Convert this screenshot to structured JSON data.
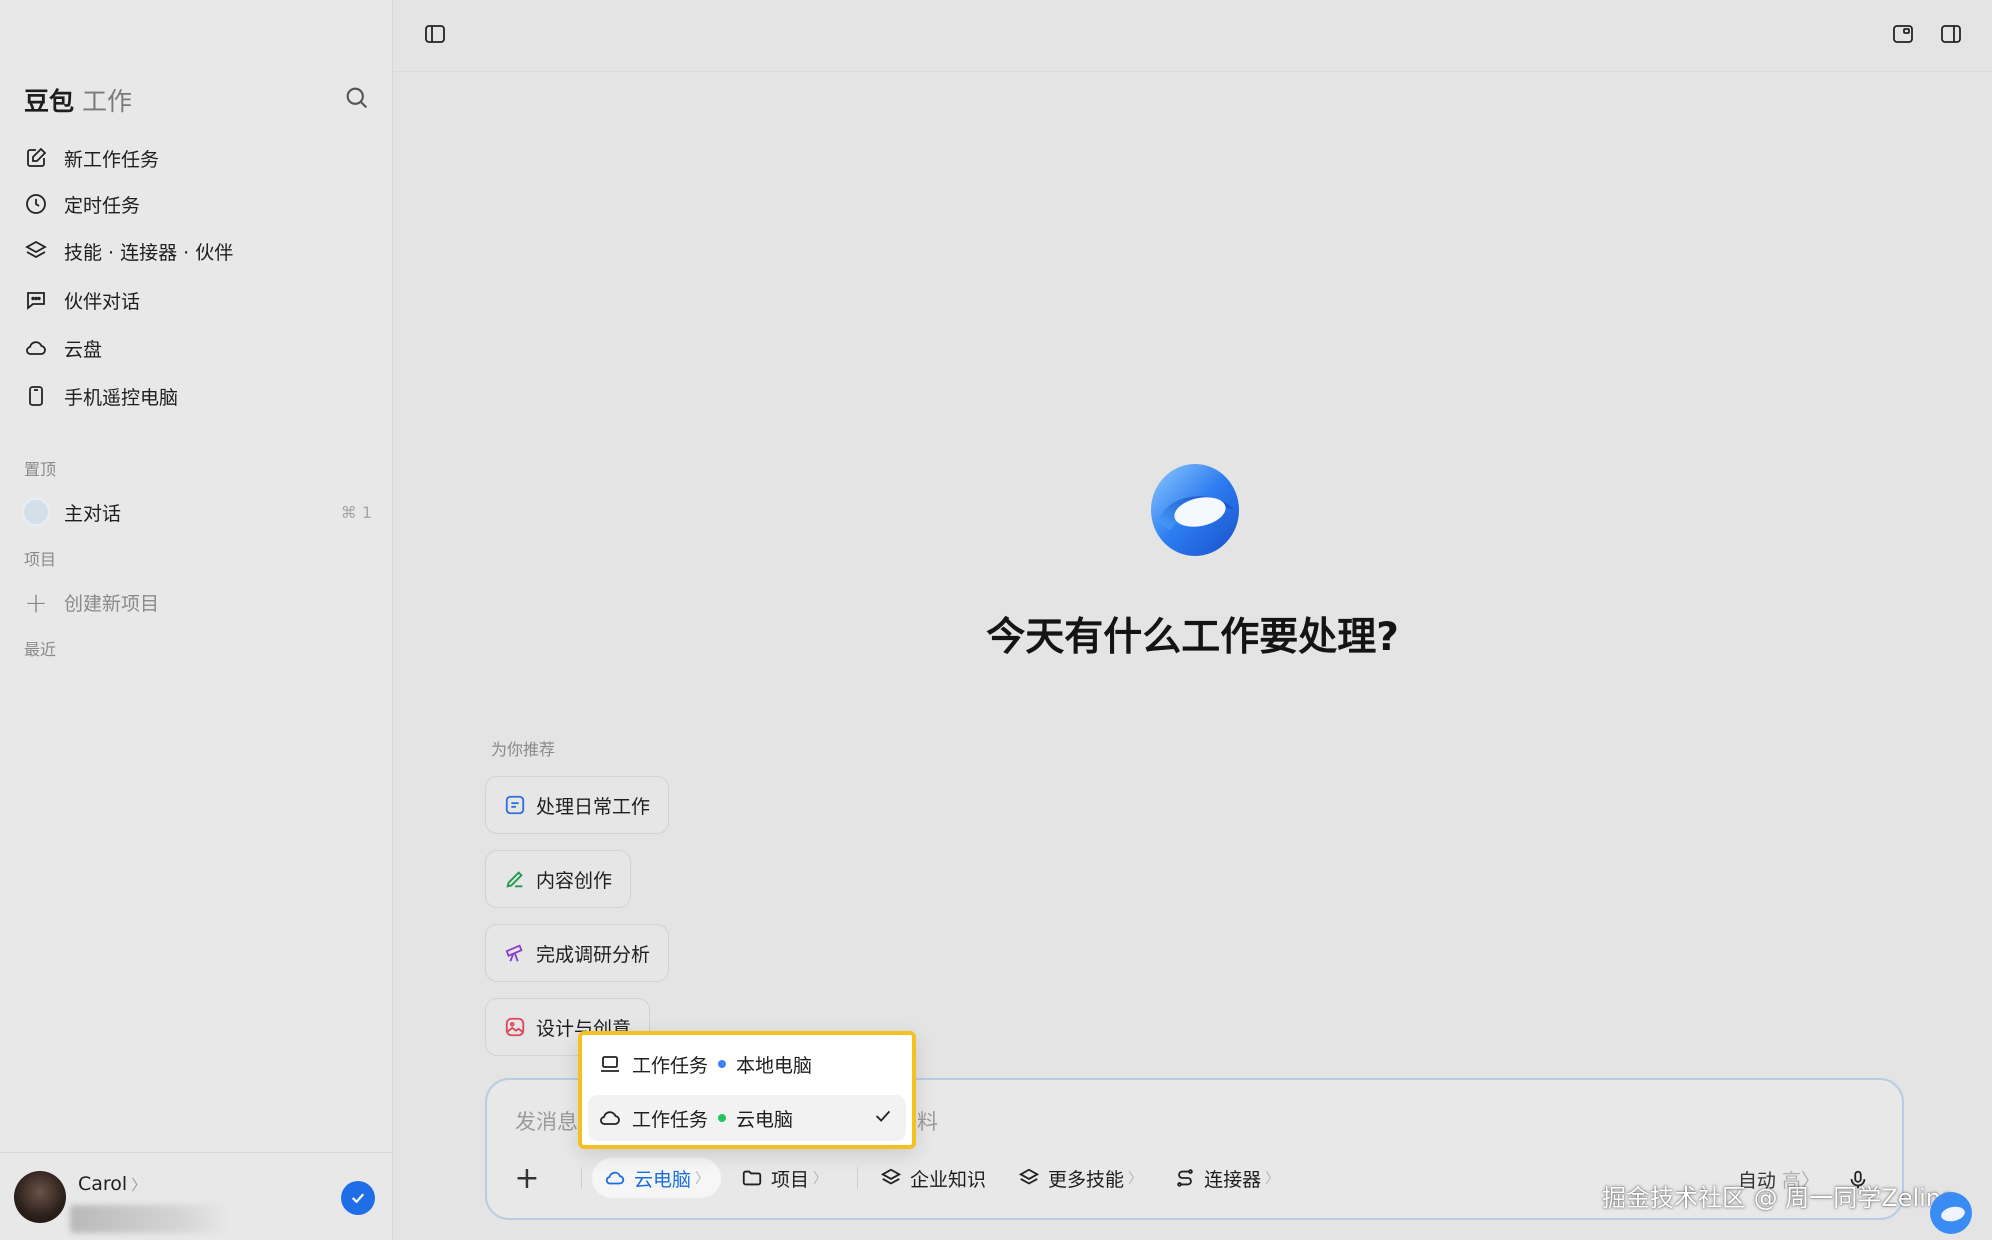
{
  "brand": {
    "name": "豆包",
    "sub": "工作"
  },
  "nav": [
    {
      "label": "新工作任务",
      "icon": "edit-icon"
    },
    {
      "label": "定时任务",
      "icon": "clock-icon"
    },
    {
      "label": "技能 · 连接器 · 伙伴",
      "icon": "layers-icon"
    },
    {
      "label": "伙伴对话",
      "icon": "chat-icon"
    },
    {
      "label": "云盘",
      "icon": "cloud-icon"
    },
    {
      "label": "手机遥控电脑",
      "icon": "phone-icon"
    }
  ],
  "sections": {
    "pinned": "置顶",
    "projects": "项目",
    "recent": "最近"
  },
  "pinned_item": {
    "label": "主对话",
    "shortcut": "⌘ 1"
  },
  "create_project": "创建新项目",
  "user": {
    "name": "Carol"
  },
  "main": {
    "headline": "今天有什么工作要处理?",
    "rec_label": "为你推荐",
    "chips": [
      {
        "label": "处理日常工作",
        "icon": "list-icon",
        "color": "#2f6fe0"
      },
      {
        "label": "内容创作",
        "icon": "pen-icon",
        "color": "#1f9a4a"
      },
      {
        "label": "完成调研分析",
        "icon": "telescope-icon",
        "color": "#8a3fd1"
      },
      {
        "label": "设计与创意",
        "icon": "image-icon",
        "color": "#e0455a"
      }
    ]
  },
  "composer": {
    "placeholder_a": "发消息",
    "placeholder_b": "料",
    "tools": [
      {
        "label": "云电脑",
        "icon": "cloud-icon",
        "active": true
      },
      {
        "label": "项目",
        "icon": "folder-icon"
      },
      {
        "label": "企业知识",
        "icon": "layers-icon"
      },
      {
        "label": "更多技能",
        "icon": "layers-icon"
      },
      {
        "label": "连接器",
        "icon": "connector-icon"
      }
    ],
    "mode": "自动",
    "mode_hint": "高"
  },
  "dropdown": {
    "items": [
      {
        "prefix": "工作任务",
        "label": "本地电脑",
        "icon": "laptop-icon",
        "dot_color": "#3b82f6",
        "selected": false
      },
      {
        "prefix": "工作任务",
        "label": "云电脑",
        "icon": "cloud-icon",
        "dot_color": "#22c55e",
        "selected": true
      }
    ]
  },
  "watermark": "掘金技术社区 @ 周一同学Zelina",
  "colors": {
    "accent": "#1f6ee8",
    "highlight_border": "#f5c022"
  }
}
